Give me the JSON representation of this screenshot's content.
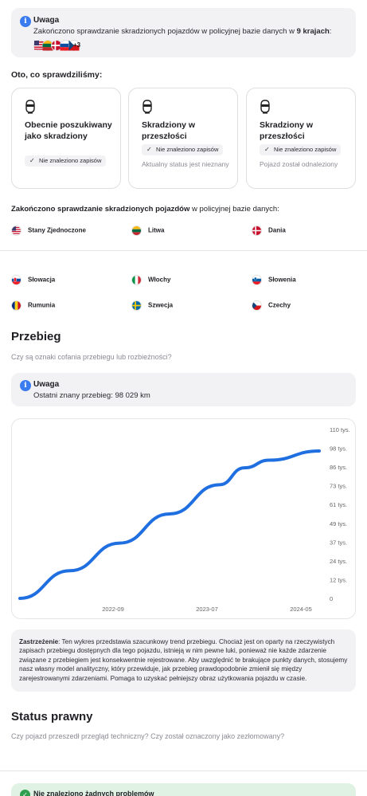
{
  "top_notice": {
    "title": "Uwaga",
    "text_before": "Zakończono sprawdzanie skradzionych pojazdów w policyjnej bazie danych w ",
    "text_bold": "9 krajach",
    "text_after": ":",
    "more_count": "+3"
  },
  "checked": {
    "heading": "Oto, co sprawdziliśmy:",
    "cards": [
      {
        "title": "Obecnie poszukiwany jako skradziony",
        "chip": "Nie znaleziono zapisów",
        "sub": ""
      },
      {
        "title": "Skradziony w przeszłości",
        "chip": "Nie znaleziono zapisów",
        "sub": "Aktualny status jest nieznany"
      },
      {
        "title": "Skradziony w przeszłości",
        "chip": "Nie znaleziono zapisów",
        "sub": "Pojazd został odnaleziony"
      }
    ]
  },
  "database": {
    "heading_bold": "Zakończono sprawdzanie skradzionych pojazdów",
    "heading_rest": " w policyjnej bazie danych:",
    "countries": [
      "Stany Zjednoczone",
      "Litwa",
      "Dania",
      "Słowacja",
      "Włochy",
      "Słowenia",
      "Rumunia",
      "Szwecja",
      "Czechy"
    ]
  },
  "mileage": {
    "title": "Przebieg",
    "subtitle": "Czy są oznaki cofania przebiegu lub rozbieżności?",
    "notice_title": "Uwaga",
    "notice_text": "Ostatni znany przebieg: 98 029 km"
  },
  "chart_data": {
    "type": "line",
    "x_tick_labels": [
      "2022-09",
      "2023-07",
      "2024-05"
    ],
    "y_tick_labels": [
      "110 tys.",
      "98 tys.",
      "86 tys.",
      "73 tys.",
      "61 tys.",
      "49 tys.",
      "37 tys.",
      "24 tys.",
      "12 tys.",
      "0"
    ],
    "ylim": [
      0,
      110000
    ],
    "points": [
      {
        "x": "2021-10",
        "y": 0
      },
      {
        "x": "2022-04",
        "y": 18000
      },
      {
        "x": "2022-10",
        "y": 36000
      },
      {
        "x": "2023-04",
        "y": 55000
      },
      {
        "x": "2023-10",
        "y": 74000
      },
      {
        "x": "2024-01",
        "y": 85000
      },
      {
        "x": "2024-04",
        "y": 90000
      },
      {
        "x": "2024-10",
        "y": 96000
      }
    ],
    "line_color": "#1f6fe0",
    "grid": false
  },
  "disclaimer": {
    "label": "Zastrzeżenie",
    "text": ": Ten wykres przedstawia szacunkowy trend przebiegu. Chociaż jest on oparty na rzeczywistych zapisach przebiegu dostępnych dla tego pojazdu, istnieją w nim pewne luki, ponieważ nie każde zdarzenie związane z przebiegiem jest konsekwentnie rejestrowane. Aby uwzględnić te brakujące punkty danych, stosujemy nasz własny model analityczny, który przewiduje, jak przebieg prawdopodobnie zmienił się między zarejestrowanymi zdarzeniami. Pomaga to uzyskać pełniejszy obraz użytkowania pojazdu w czasie."
  },
  "legal": {
    "title": "Status prawny",
    "subtitle": "Czy pojazd przeszedł przegląd techniczny? Czy został oznaczony jako zezłomowany?",
    "status_text": "Nie znaleziono żadnych problemów"
  },
  "colors": {
    "accent": "#3a7bf0",
    "success": "#2e9e4f"
  }
}
